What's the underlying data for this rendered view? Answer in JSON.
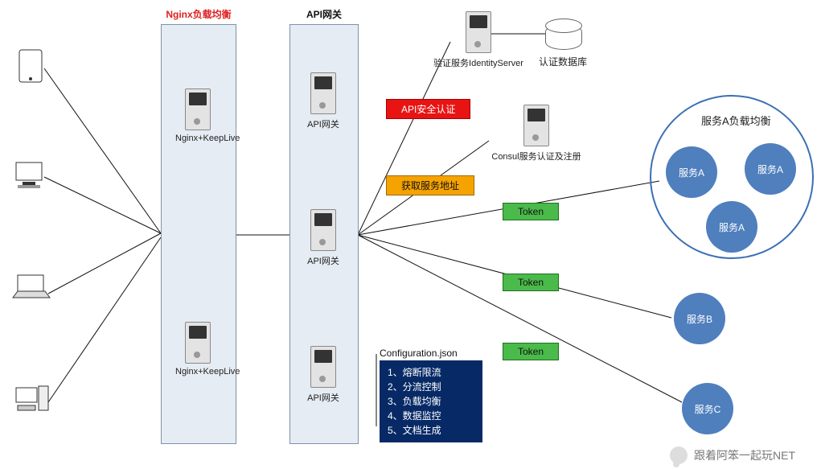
{
  "columns": {
    "nginx": {
      "title": "Nginx负载均衡"
    },
    "api": {
      "title": "API网关"
    }
  },
  "servers": {
    "nginx1": "Nginx+KeepLive",
    "nginx2": "Nginx+KeepLive",
    "api1": "API网关",
    "api2": "API网关",
    "api3": "API网关",
    "identity": "验证服务IdentityServer",
    "consul": "Consul服务认证及注册"
  },
  "db": {
    "auth": "认证数据库"
  },
  "tags": {
    "apiSec": "API安全认证",
    "svcAddr": "获取服务地址",
    "token1": "Token",
    "token2": "Token",
    "token3": "Token"
  },
  "config": {
    "title": "Configuration.json",
    "lines": [
      "1、熔断限流",
      "2、分流控制",
      "3、负载均衡",
      "4、数据监控",
      "5、文档生成"
    ]
  },
  "serviceA": {
    "title": "服务A负载均衡",
    "nodes": [
      "服务A",
      "服务A",
      "服务A"
    ]
  },
  "services": {
    "b": "服务B",
    "c": "服务C"
  },
  "watermark": "跟着阿笨一起玩NET"
}
